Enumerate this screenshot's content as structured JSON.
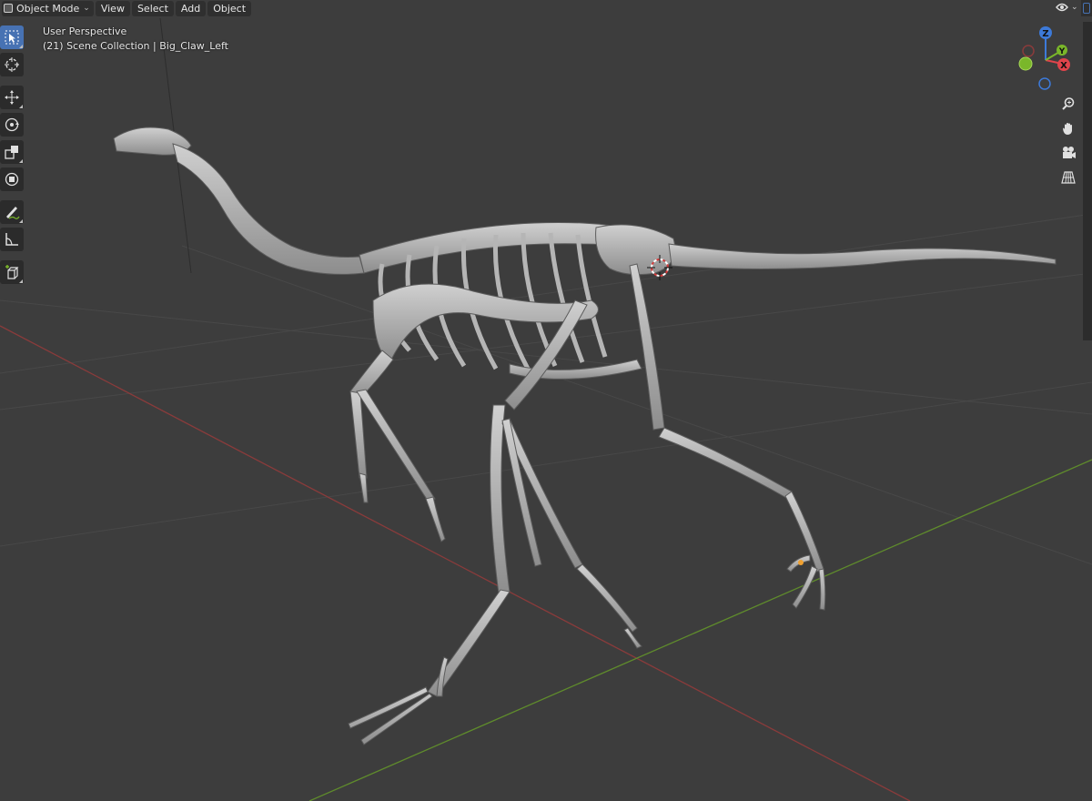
{
  "header": {
    "mode_label": "Object Mode",
    "menu": [
      "View",
      "Select",
      "Add",
      "Object"
    ]
  },
  "overlay": {
    "perspective": "User Perspective",
    "collection": "(21) Scene Collection | Big_Claw_Left"
  },
  "toolbar": {
    "tools": [
      {
        "name": "select-box-icon",
        "active": true
      },
      {
        "name": "cursor-icon",
        "active": false
      },
      {
        "name": "move-icon",
        "active": false
      },
      {
        "name": "rotate-icon",
        "active": false
      },
      {
        "name": "scale-icon",
        "active": false
      },
      {
        "name": "transform-icon",
        "active": false
      },
      {
        "name": "annotate-icon",
        "active": false
      },
      {
        "name": "measure-icon",
        "active": false
      },
      {
        "name": "add-cube-icon",
        "active": false
      }
    ]
  },
  "gizmo": {
    "axes": [
      "Z",
      "Y",
      "X"
    ],
    "colors": {
      "x": "#e0444b",
      "y": "#7ab72a",
      "z": "#3d7ad9"
    }
  },
  "nav_buttons": [
    "zoom-icon",
    "hand-pan-icon",
    "camera-icon",
    "grid-ortho-icon"
  ],
  "colors": {
    "background": "#3d3d3d",
    "accent": "#4772b3",
    "bone": "#b9b9b9",
    "x_axis_line": "#8a3b3b",
    "y_axis_line": "#5f8b2c"
  }
}
